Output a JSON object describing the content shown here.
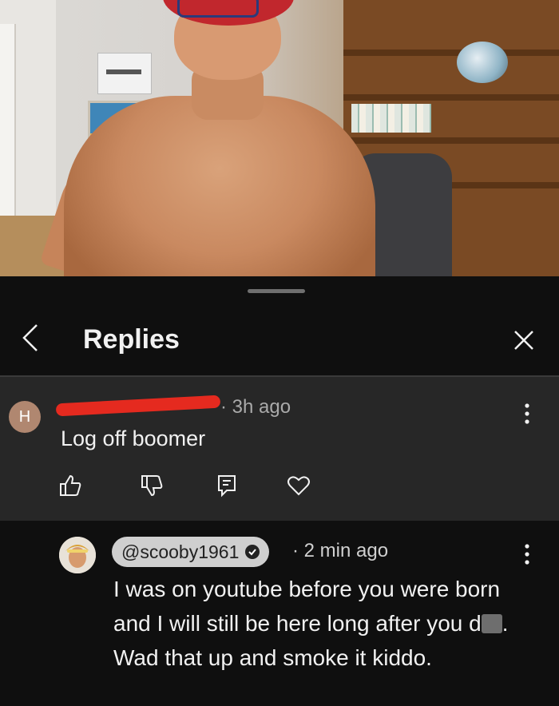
{
  "header": {
    "title": "Replies",
    "back_icon": "chevron-left-icon",
    "close_icon": "close-icon"
  },
  "comment1": {
    "avatar_letter": "H",
    "time": "· 3h ago",
    "text": "Log off boomer",
    "menu_icon": "more-vertical-icon",
    "actions": [
      "like-icon",
      "dislike-icon",
      "reply-icon",
      "heart-icon"
    ]
  },
  "comment2": {
    "handle": "@scooby1961",
    "time": "· 2 min ago",
    "text_part1": "I was on youtube before you were born and I will still be here long after you d",
    "text_part2": ".  Wad that up and smoke it kiddo.",
    "menu_icon": "more-vertical-icon"
  },
  "colors": {
    "background": "#0f0f0f",
    "reply_panel": "#272727",
    "redaction": "#e52a1f",
    "hat": "#c1272d"
  }
}
